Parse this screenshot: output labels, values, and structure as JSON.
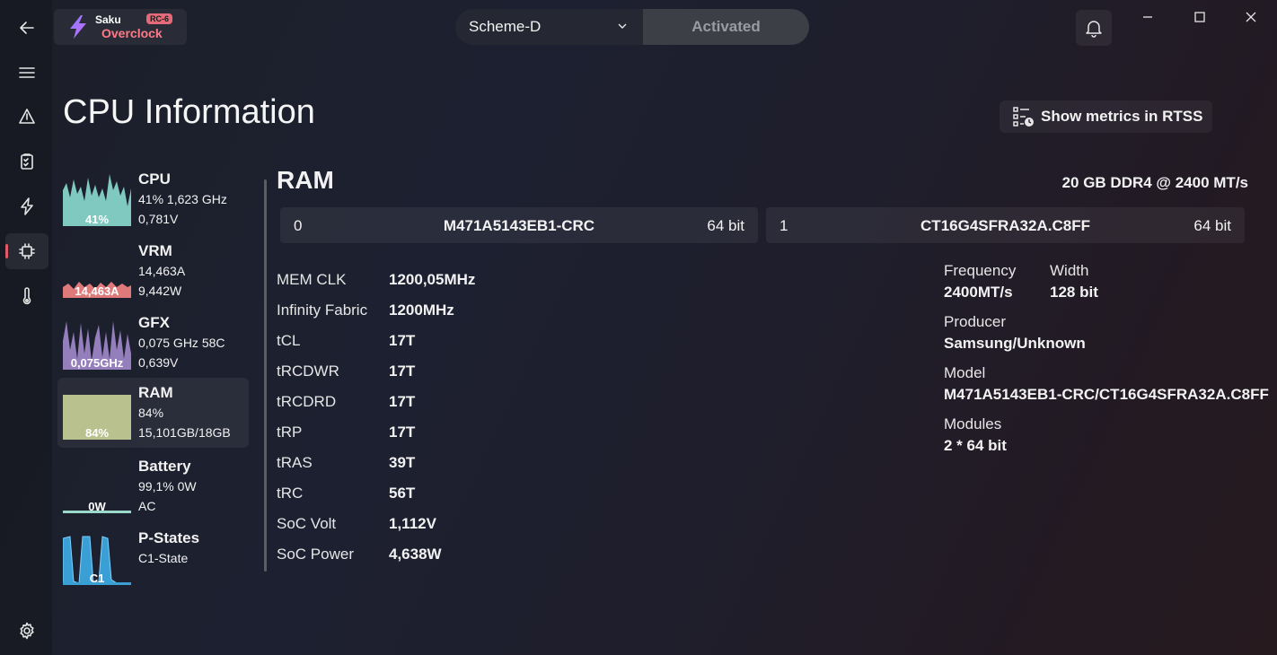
{
  "app": {
    "name_line1": "Saku",
    "name_line2": "Overclock",
    "badge": "RC-6"
  },
  "header": {
    "scheme": "Scheme-D",
    "status": "Activated"
  },
  "page": {
    "title": "CPU Information",
    "rtss_button": "Show metrics in RTSS"
  },
  "monitors": [
    {
      "name": "CPU",
      "line1": "41%  1,623 GHz",
      "line2": "0,781V",
      "graph_label": "41%",
      "color": "#7fc9c0"
    },
    {
      "name": "VRM",
      "line1": "14,463A",
      "line2": "9,442W",
      "graph_label": "14,463A",
      "color": "#e07a7a"
    },
    {
      "name": "GFX",
      "line1": "0,075 GHz  58C",
      "line2": "0,639V",
      "graph_label": "0,075GHz",
      "color": "#a98fd6"
    },
    {
      "name": "RAM",
      "line1": "84%",
      "line2": "15,101GB/18GB",
      "graph_label": "84%",
      "color": "#b9c18f"
    },
    {
      "name": "Battery",
      "line1": "99,1% 0W",
      "line2": "AC",
      "graph_label": "0W",
      "color": "#9ad8c9"
    },
    {
      "name": "P-States",
      "line1": "C1-State",
      "line2": "",
      "graph_label": "C1",
      "color": "#3a9fd4"
    }
  ],
  "ram": {
    "heading": "RAM",
    "summary": "20 GB DDR4 @ 2400 MT/s",
    "modules": [
      {
        "index": "0",
        "part": "M471A5143EB1-CRC",
        "bits": "64 bit"
      },
      {
        "index": "1",
        "part": "CT16G4SFRA32A.C8FF",
        "bits": "64 bit"
      }
    ],
    "timings": [
      {
        "label": "MEM CLK",
        "value": "1200,05MHz"
      },
      {
        "label": "Infinity Fabric",
        "value": "1200MHz"
      },
      {
        "label": "tCL",
        "value": "17T"
      },
      {
        "label": "tRCDWR",
        "value": "17T"
      },
      {
        "label": "tRCDRD",
        "value": "17T"
      },
      {
        "label": "tRP",
        "value": "17T"
      },
      {
        "label": "tRAS",
        "value": "39T"
      },
      {
        "label": "tRC",
        "value": "56T"
      },
      {
        "label": "SoC Volt",
        "value": "1,112V"
      },
      {
        "label": "SoC Power",
        "value": "4,638W"
      }
    ],
    "info": {
      "frequency_label": "Frequency",
      "frequency": "2400MT/s",
      "width_label": "Width",
      "width": "128 bit",
      "producer_label": "Producer",
      "producer": "Samsung/Unknown",
      "model_label": "Model",
      "model": "M471A5143EB1-CRC/CT16G4SFRA32A.C8FF",
      "modules_label": "Modules",
      "modules": "2 * 64 bit"
    }
  }
}
